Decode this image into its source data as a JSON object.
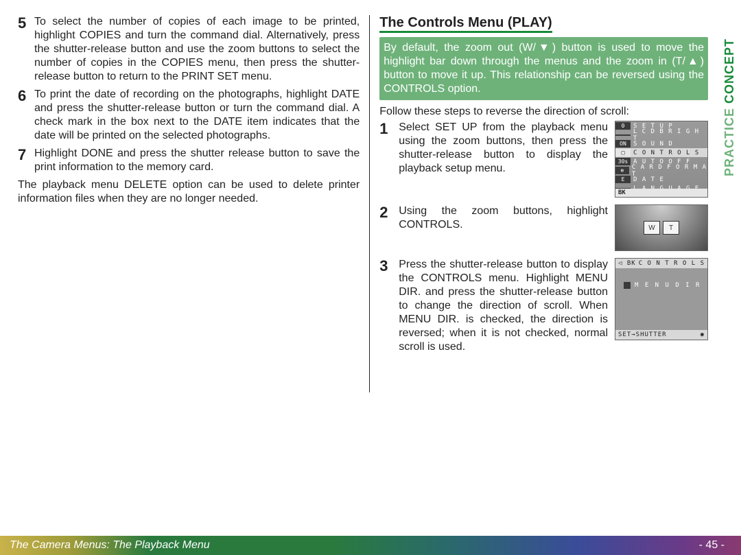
{
  "left": {
    "item5": {
      "num": "5",
      "text": "To select the number of copies of each image to be printed, highlight COPIES and turn the command dial.  Alternatively, press the shutter-release button and use the zoom buttons to select the number of copies in the COPIES menu, then press the shutter-release button to return to the PRINT SET menu."
    },
    "item6": {
      "num": "6",
      "text": "To print the date of recording on the photographs, highlight DATE and press the shutter-release button or turn the command dial.  A check mark in the box next to the DATE item indicates that the date will be printed on the selected photographs."
    },
    "item7": {
      "num": "7",
      "text": "Highlight DONE and press the shutter release button to save the print information to the memory card."
    },
    "tail": "The playback menu DELETE option can be used to delete printer information files when they are no longer needed."
  },
  "right": {
    "heading": "The Controls Menu (PLAY)",
    "greenbox": "By default, the zoom out (W/▼) button is used to move the highlight bar down through the menus and the zoom in (T/▲) button to move it up.  This relationship can be reversed using the CONTROLS option.",
    "follow": "Follow these steps to reverse the direction of scroll:",
    "step1": {
      "num": "1",
      "text": "Select SET UP from the playback menu using the zoom buttons, then press the shutter-release button to display the playback setup menu."
    },
    "step2": {
      "num": "2",
      "text": "Using the zoom buttons, highlight CONTROLS."
    },
    "step3": {
      "num": "3",
      "text": "Press the shutter-release button to display the CONTROLS menu.  Highlight MENU DIR. and press the shutter-release button to change the direction of scroll.  When MENU DIR. is checked, the direction is reversed; when it is not checked, normal scroll is used."
    }
  },
  "lcd1": {
    "rows": [
      {
        "tag": "0",
        "label": "S E T  U P"
      },
      {
        "tag": "",
        "label": "L C D  B R I G H T"
      },
      {
        "tag": "ON",
        "label": "S O U N D"
      },
      {
        "tag": "□",
        "label": "C O N T R O L S",
        "hi": true
      },
      {
        "tag": "30s",
        "label": "A U T O  O F F"
      },
      {
        "tag": "⊕",
        "label": "C A R D F O R M A T"
      },
      {
        "tag": "E",
        "label": "D A T E"
      },
      {
        "tag": "",
        "label": "L A N G U A G E"
      }
    ],
    "bk": "BK"
  },
  "lcd2": {
    "w": "W",
    "t": "T"
  },
  "lcd3": {
    "hdr_left": "◁ BK",
    "hdr_right": "C O N T R O L S",
    "item": "M E N U   D I R",
    "ftr": "SET→SHUTTER",
    "ftr_icon": "◉"
  },
  "side": {
    "concept": "CONCEPT",
    "practice": "PRACTICE "
  },
  "footer": {
    "title": "The Camera Menus: The Playback Menu",
    "page": "- 45 -"
  }
}
